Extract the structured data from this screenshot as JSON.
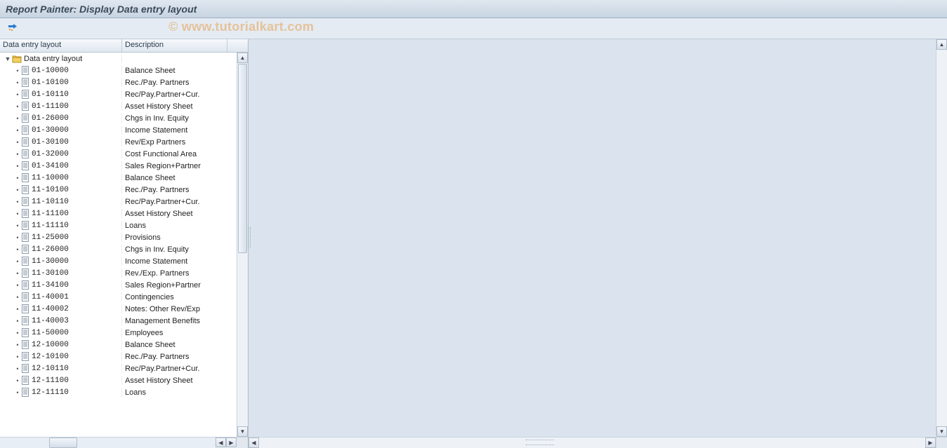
{
  "title": "Report Painter: Display Data entry layout",
  "watermark": "© www.tutorialkart.com",
  "tree": {
    "headers": {
      "code": "Data entry layout",
      "desc": "Description"
    },
    "root": {
      "label": "Data entry layout"
    },
    "items": [
      {
        "code": "01-10000",
        "desc": "Balance Sheet"
      },
      {
        "code": "01-10100",
        "desc": "Rec./Pay. Partners"
      },
      {
        "code": "01-10110",
        "desc": "Rec/Pay.Partner+Cur."
      },
      {
        "code": "01-11100",
        "desc": "Asset History Sheet"
      },
      {
        "code": "01-26000",
        "desc": "Chgs in Inv. Equity"
      },
      {
        "code": "01-30000",
        "desc": "Income Statement"
      },
      {
        "code": "01-30100",
        "desc": "Rev/Exp Partners"
      },
      {
        "code": "01-32000",
        "desc": "Cost Functional Area"
      },
      {
        "code": "01-34100",
        "desc": "Sales Region+Partner"
      },
      {
        "code": "11-10000",
        "desc": "Balance Sheet"
      },
      {
        "code": "11-10100",
        "desc": "Rec./Pay. Partners"
      },
      {
        "code": "11-10110",
        "desc": "Rec/Pay.Partner+Cur."
      },
      {
        "code": "11-11100",
        "desc": "Asset History Sheet"
      },
      {
        "code": "11-11110",
        "desc": "Loans"
      },
      {
        "code": "11-25000",
        "desc": "Provisions"
      },
      {
        "code": "11-26000",
        "desc": "Chgs in Inv. Equity"
      },
      {
        "code": "11-30000",
        "desc": "Income Statement"
      },
      {
        "code": "11-30100",
        "desc": "Rev./Exp. Partners"
      },
      {
        "code": "11-34100",
        "desc": "Sales Region+Partner"
      },
      {
        "code": "11-40001",
        "desc": "Contingencies"
      },
      {
        "code": "11-40002",
        "desc": "Notes: Other Rev/Exp"
      },
      {
        "code": "11-40003",
        "desc": "Management Benefits"
      },
      {
        "code": "11-50000",
        "desc": "Employees"
      },
      {
        "code": "12-10000",
        "desc": "Balance Sheet"
      },
      {
        "code": "12-10100",
        "desc": "Rec./Pay. Partners"
      },
      {
        "code": "12-10110",
        "desc": "Rec/Pay.Partner+Cur."
      },
      {
        "code": "12-11100",
        "desc": "Asset History Sheet"
      },
      {
        "code": "12-11110",
        "desc": "Loans"
      }
    ]
  }
}
